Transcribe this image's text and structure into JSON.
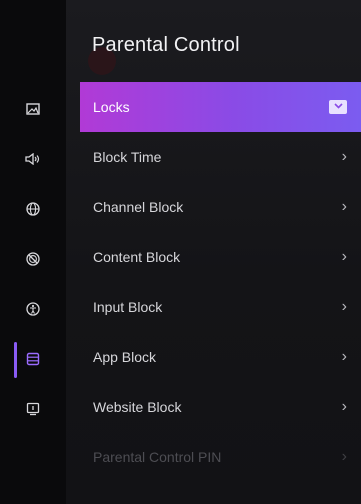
{
  "title": "Parental Control",
  "menu": {
    "items": [
      {
        "label": "Locks"
      },
      {
        "label": "Block Time"
      },
      {
        "label": "Channel Block"
      },
      {
        "label": "Content Block"
      },
      {
        "label": "Input Block"
      },
      {
        "label": "App Block"
      },
      {
        "label": "Website Block"
      },
      {
        "label": "Parental Control PIN"
      }
    ]
  },
  "sidebar": {
    "icons": [
      "picture-icon",
      "sound-icon",
      "globe-icon",
      "no-entry-icon",
      "accessibility-icon",
      "list-icon",
      "tv-info-icon"
    ]
  },
  "colors": {
    "accent": "#8a5cf6",
    "active_gradient_start": "#b13ad6",
    "active_gradient_end": "#7b5cf0"
  }
}
